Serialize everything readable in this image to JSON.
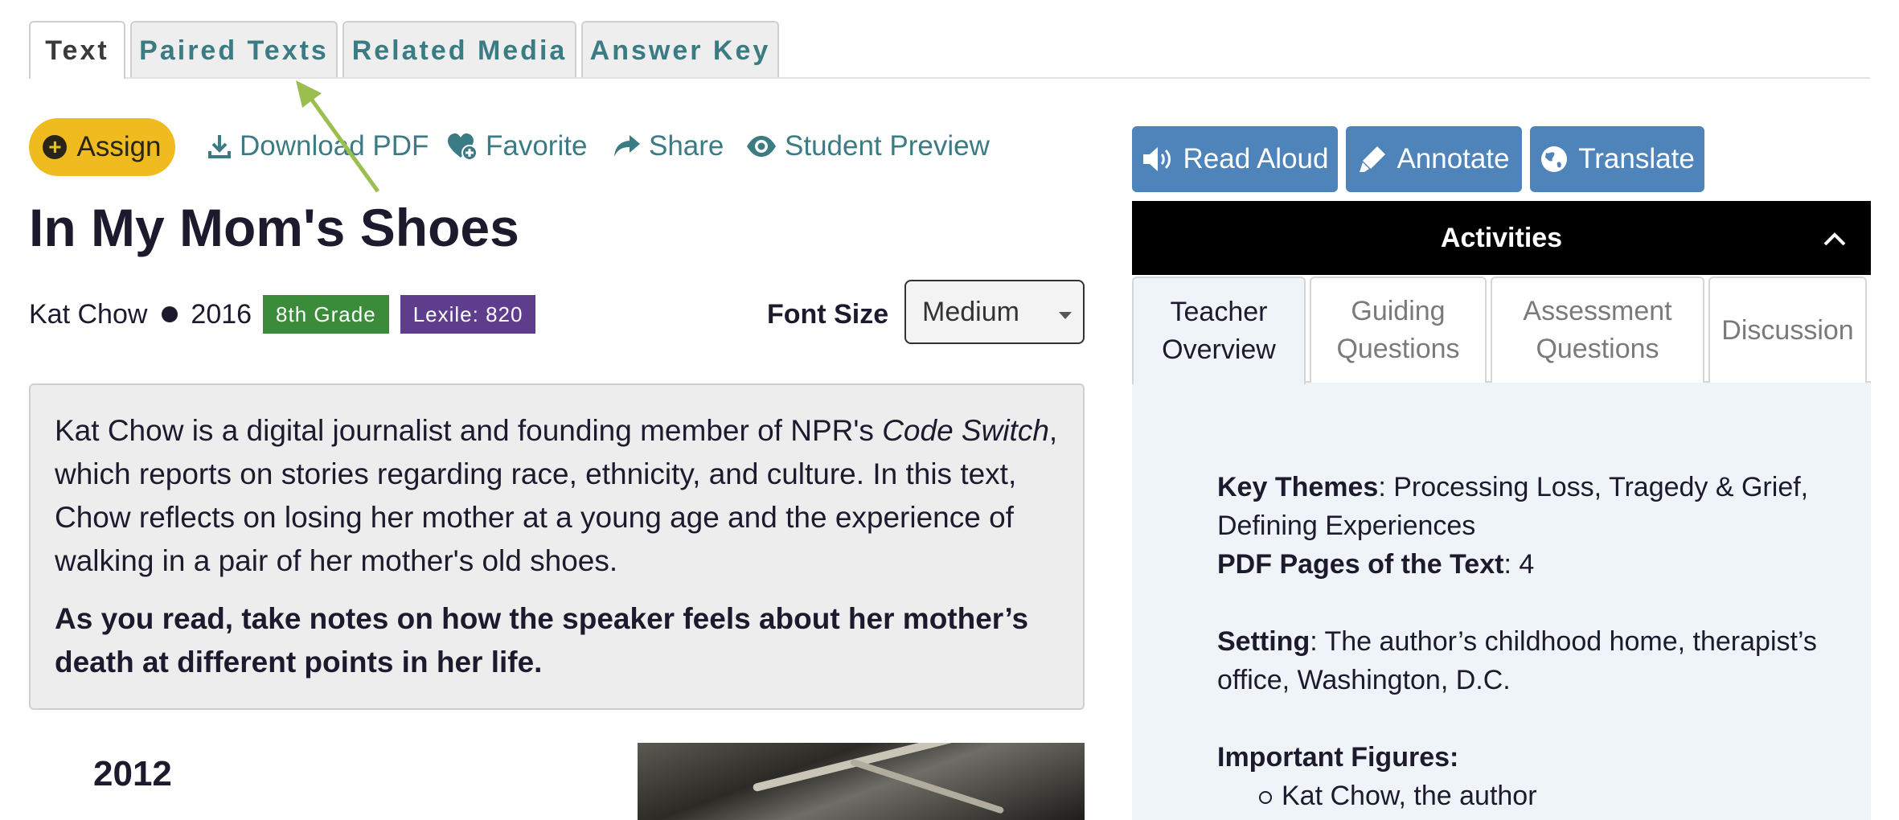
{
  "tabs": [
    {
      "label": "Text",
      "active": true
    },
    {
      "label": "Paired Texts",
      "active": false
    },
    {
      "label": "Related Media",
      "active": false
    },
    {
      "label": "Answer Key",
      "active": false
    }
  ],
  "actions": {
    "assign": "Assign",
    "download_pdf": "Download PDF",
    "favorite": "Favorite",
    "share": "Share",
    "student_preview": "Student Preview"
  },
  "text": {
    "title": "In My Mom's Shoes",
    "author": "Kat Chow",
    "year": "2016",
    "grade_badge": "8th Grade",
    "lexile_badge": "Lexile: 820",
    "font_size_label": "Font Size",
    "font_size_value": "Medium",
    "intro_part1": "Kat Chow is a digital journalist and founding member of NPR's ",
    "intro_italic": "Code Switch",
    "intro_part2": ", which reports on stories regarding race, ethnicity, and culture. In this text, Chow reflects on losing her mother at a young age and the experience of walking in a pair of her mother's old shoes.",
    "instruction": "As you read, take notes on how the speaker feels about her mother’s death at different points in her life.",
    "section_year": "2012"
  },
  "tools": {
    "read_aloud": "Read Aloud",
    "annotate": "Annotate",
    "translate": "Translate"
  },
  "activities": {
    "header": "Activities",
    "tabs": [
      {
        "line1": "Teacher",
        "line2": "Overview",
        "active": true
      },
      {
        "line1": "Guiding",
        "line2": "Questions",
        "active": false
      },
      {
        "line1": "Assessment",
        "line2": "Questions",
        "active": false
      },
      {
        "line1": "Discussion",
        "line2": "",
        "active": false
      }
    ],
    "overview": {
      "key_themes_label": "Key Themes",
      "key_themes_value": ": Processing Loss, Tragedy & Grief, Defining Experiences",
      "pdf_pages_label": "PDF Pages of the Text",
      "pdf_pages_value": ": 4",
      "setting_label": "Setting",
      "setting_value": ": The author’s childhood home, therapist’s office, Washington, D.C.",
      "figures_label": "Important Figures:",
      "figures": [
        "Kat Chow, the author"
      ]
    }
  },
  "colors": {
    "tab_text": "#3b7b83",
    "assign_yellow": "#f0bb1e",
    "grade_green": "#3a8c3a",
    "lexile_purple": "#5e3e8c",
    "tool_blue": "#4f84ba",
    "arrow_green": "#9bbf4f"
  },
  "icons": [
    "plus-circle-icon",
    "download-icon",
    "heart-plus-icon",
    "share-arrow-icon",
    "eye-icon",
    "volume-icon",
    "highlighter-icon",
    "globe-icon",
    "chevron-up-icon",
    "caret-down-icon"
  ]
}
